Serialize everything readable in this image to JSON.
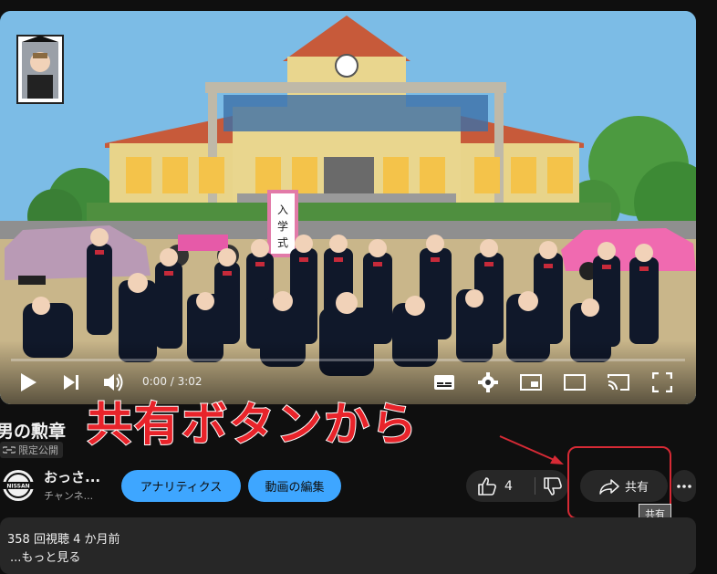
{
  "player": {
    "time_display": "0:00 / 3:02",
    "progress": 0,
    "sign_text": "入学式"
  },
  "video": {
    "title": "男の勲章",
    "privacy_label": "限定公開"
  },
  "annotation": {
    "text": "共有ボタンから",
    "color": "#e8232a"
  },
  "channel": {
    "name": "おっさ...",
    "subscribers": "チャンネ...",
    "avatar_text": "NISSAN"
  },
  "actions": {
    "analytics_label": "アナリティクス",
    "edit_label": "動画の編集",
    "like_count": "4",
    "share_label": "共有",
    "share_tooltip": "共有"
  },
  "description": {
    "meta": "358 回視聴  4 か月前",
    "more_label": "...もっと見る"
  },
  "icons": [
    "play-icon",
    "next-icon",
    "volume-icon",
    "subtitles-icon",
    "settings-icon",
    "miniplayer-icon",
    "theater-icon",
    "cast-icon",
    "fullscreen-icon",
    "like-icon",
    "dislike-icon",
    "share-icon",
    "more-icon",
    "lock-icon"
  ],
  "colors": {
    "accent_blue": "#3ea6ff",
    "progress_red": "#ff0000",
    "background": "#0f0f0f",
    "chip_gray": "#272727"
  }
}
